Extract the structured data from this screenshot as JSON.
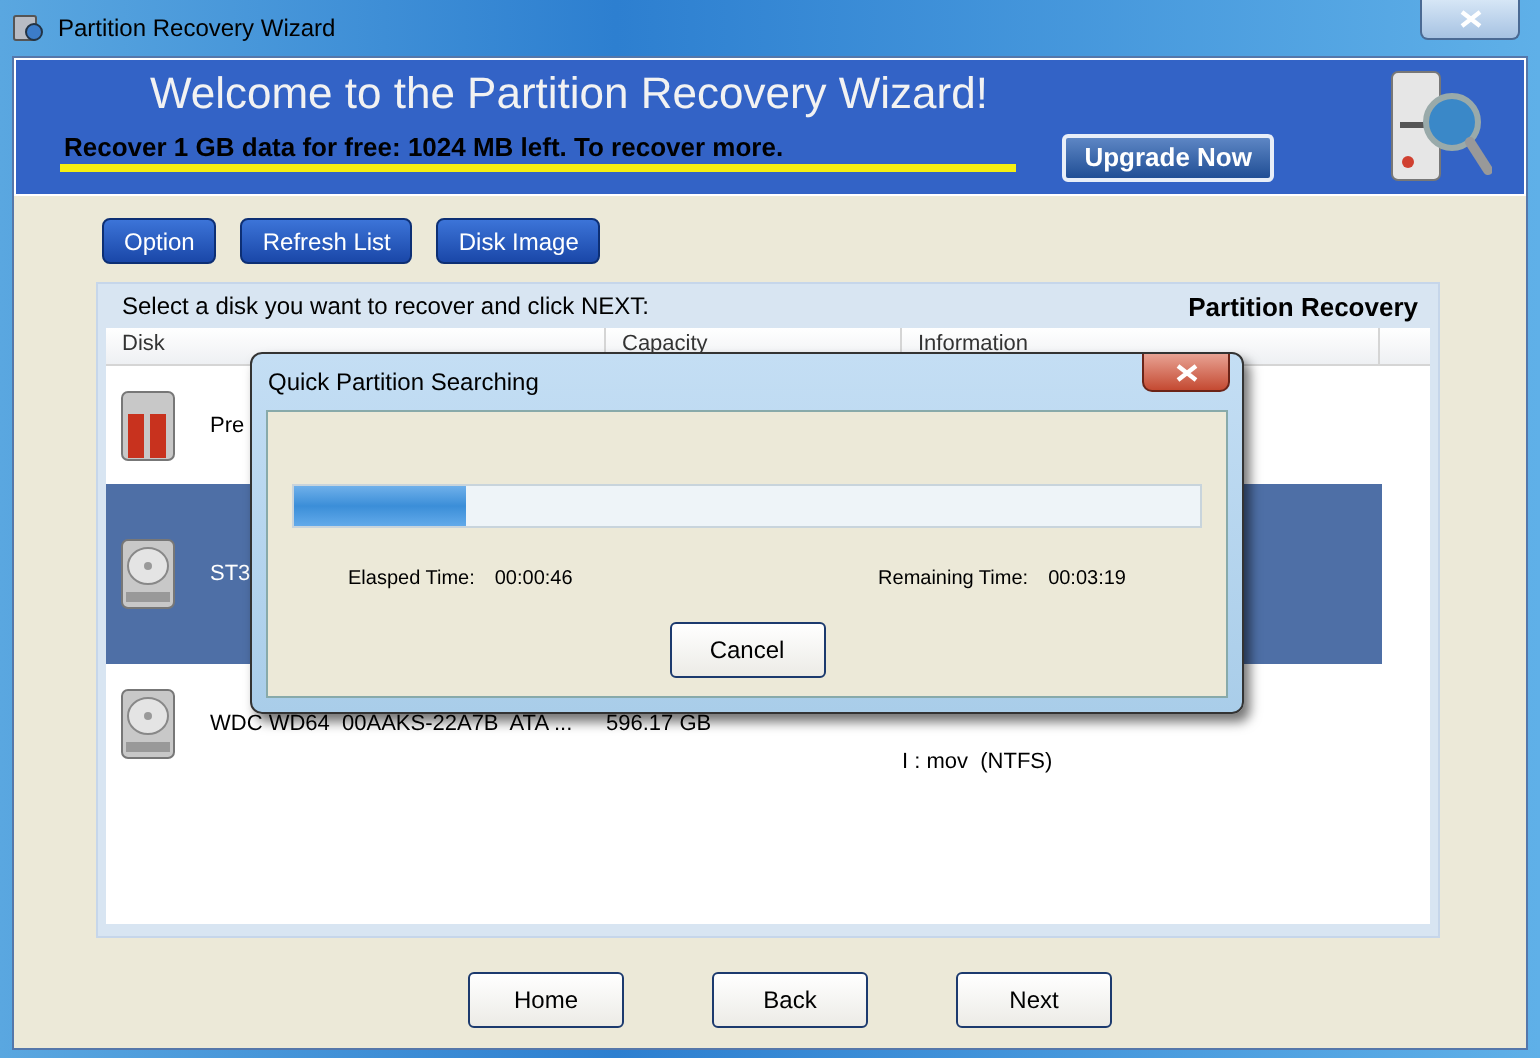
{
  "window": {
    "title": "Partition Recovery Wizard"
  },
  "banner": {
    "heading": "Welcome to the Partition Recovery Wizard!",
    "notice": "Recover 1 GB data for free: 1024 MB left. To recover more.",
    "upgrade": "Upgrade Now"
  },
  "toolbar": [
    "Option",
    "Refresh List",
    "Disk Image"
  ],
  "panel": {
    "instruction": "Select a disk you want to recover and click NEXT:",
    "title": "Partition Recovery",
    "columns": [
      "Disk",
      "Capacity",
      "Information"
    ],
    "rows": [
      {
        "kind": "removable",
        "disk": "Pre",
        "selected": false
      },
      {
        "kind": "hdd",
        "disk": "ST3",
        "selected": true
      },
      {
        "kind": "hdd",
        "disk": "WDC WD64  00AAKS-22A7B  ATA ...",
        "capacity": "596.17 GB",
        "information": "I : mov  (NTFS)",
        "selected": false
      }
    ]
  },
  "dialog": {
    "title": "Quick Partition Searching",
    "level": 0.19,
    "elapsed_label": "Elasped Time:",
    "elapsed": "00:00:46",
    "remaining_label": "Remaining Time:",
    "remaining": "00:03:19",
    "cancel": "Cancel"
  },
  "nav": [
    "Home",
    "Back",
    "Next"
  ]
}
